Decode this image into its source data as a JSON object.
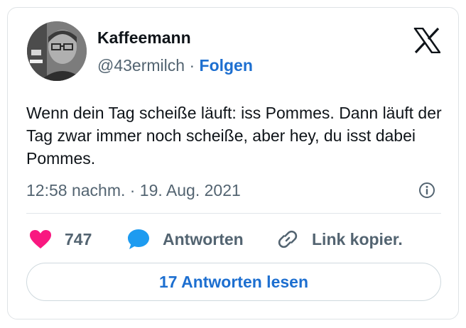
{
  "author": {
    "name": "Kaffeemann",
    "handle": "@43ermilch",
    "separator": "·",
    "follow_label": "Folgen"
  },
  "tweet": {
    "text": "Wenn dein Tag scheiße läuft: iss Pommes. Dann läuft der Tag zwar immer noch scheiße, aber hey, du isst dabei Pommes.",
    "timestamp": "12:58 nachm. · 19. Aug. 2021"
  },
  "actions": {
    "like_count": "747",
    "reply_label": "Antworten",
    "copy_label": "Link kopier."
  },
  "read_replies_label": "17 Antworten lesen",
  "icons": {
    "logo": "x-logo-icon",
    "info": "info-icon",
    "like": "heart-icon",
    "reply": "speech-bubble-icon",
    "copy": "link-icon"
  },
  "colors": {
    "like": "#f91880",
    "reply": "#1d9bf0",
    "link_blue": "#1d6fd0",
    "secondary_text": "#536471"
  }
}
